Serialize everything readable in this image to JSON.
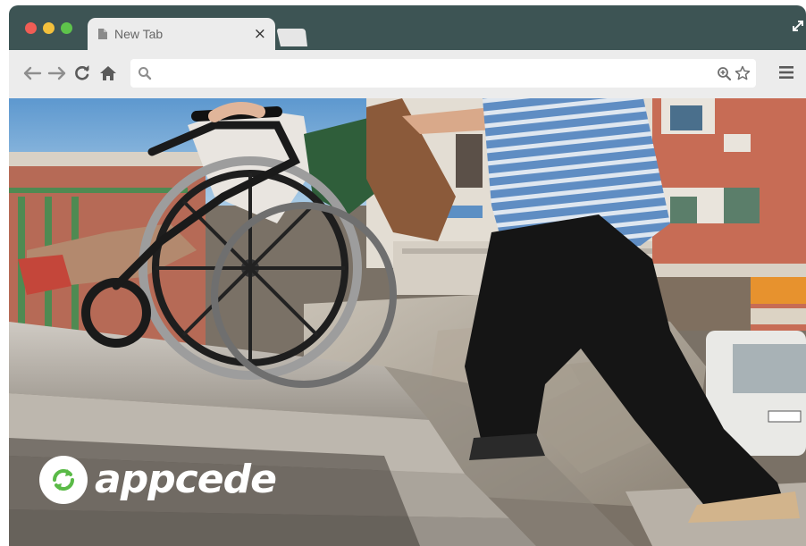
{
  "window": {
    "traffic_lights": {
      "close_color": "#f05d55",
      "minimize_color": "#f3c03c",
      "maximize_color": "#5ec34b"
    },
    "frame_color": "#3d5454"
  },
  "tab": {
    "title": "New Tab",
    "close_label": "×",
    "icon": "page-icon"
  },
  "toolbar": {
    "back_icon": "back-arrow-icon",
    "forward_icon": "forward-arrow-icon",
    "reload_icon": "reload-icon",
    "home_icon": "home-icon",
    "menu_icon": "hamburger-menu-icon"
  },
  "address_bar": {
    "value": "",
    "placeholder": "",
    "search_icon": "search-icon",
    "zoom_icon": "zoom-icon",
    "bookmark_icon": "star-icon"
  },
  "content": {
    "logo_text": "appcede",
    "logo_icon": "recycle-arrows-icon",
    "brand_color": "#5aba47"
  }
}
